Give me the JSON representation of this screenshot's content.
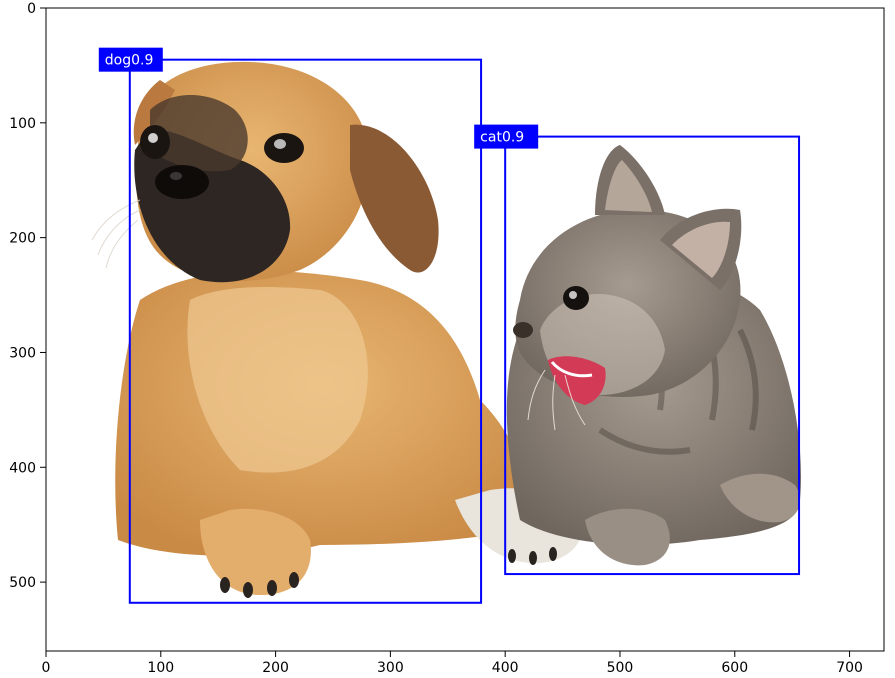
{
  "figure": {
    "x_ticks": [
      "0",
      "100",
      "200",
      "300",
      "400",
      "500",
      "600",
      "700"
    ],
    "y_ticks": [
      "0",
      "100",
      "200",
      "300",
      "400",
      "500"
    ],
    "x_tick_values": [
      0,
      100,
      200,
      300,
      400,
      500,
      600,
      700
    ],
    "y_tick_values": [
      0,
      100,
      200,
      300,
      400,
      500
    ],
    "xlim": [
      0,
      730
    ],
    "ylim": [
      560,
      0
    ]
  },
  "detections": [
    {
      "label": "dog0.9",
      "bbox_xyxy": [
        73,
        45,
        379,
        518
      ],
      "color": "#0000ff"
    },
    {
      "label": "cat0.9",
      "bbox_xyxy": [
        400,
        112,
        656,
        493
      ],
      "color": "#0000ff"
    }
  ],
  "photo": {
    "subjects": [
      "puppy-icon",
      "kitten-icon"
    ],
    "colors": {
      "dog_fur": "#d9a05a",
      "dog_muzzle": "#2b2420",
      "cat_fur": "#8c8279",
      "cat_mouth": "#d23a55"
    }
  }
}
